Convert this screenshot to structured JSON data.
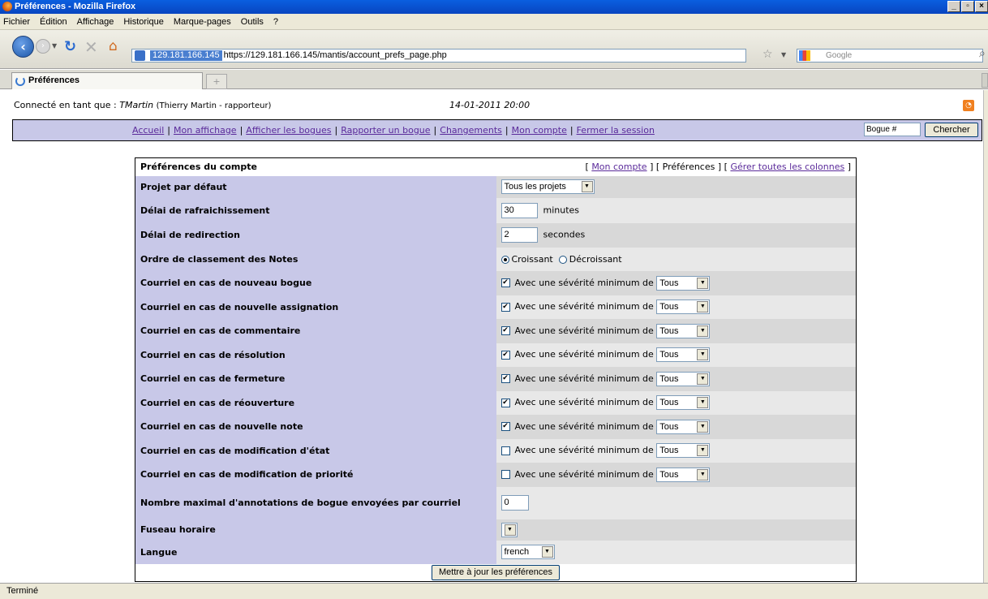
{
  "window": {
    "title": "Préférences - Mozilla Firefox"
  },
  "menubar": [
    "Fichier",
    "Édition",
    "Affichage",
    "Historique",
    "Marque-pages",
    "Outils",
    "?"
  ],
  "urlbar": {
    "site": "129.181.166.145",
    "url": "https://129.181.166.145/mantis/account_prefs_page.php"
  },
  "searchbar": {
    "placeholder": "Google"
  },
  "tab": {
    "title": "Préférences",
    "new_tab": "+"
  },
  "header": {
    "login_prefix": "Connecté en tant que :",
    "username": "TMartin",
    "user_detail": "(Thierry Martin - rapporteur)",
    "datetime": "14-01-2011 20:00"
  },
  "mainmenu": {
    "links": [
      "Accueil",
      "Mon affichage",
      "Afficher les bogues",
      "Rapporter un bogue",
      "Changements",
      "Mon compte",
      "Fermer la session"
    ],
    "separator": "|",
    "bug_input": "Bogue #",
    "search_button": "Chercher"
  },
  "form": {
    "title": "Préférences du compte",
    "nav": {
      "open": "[",
      "close": "]",
      "my_account": "Mon compte",
      "preferences": "Préférences",
      "manage_columns": "Gérer toutes les colonnes"
    },
    "default_project": {
      "label": "Projet par défaut",
      "value": "Tous les projets"
    },
    "refresh_delay": {
      "label": "Délai de rafraichissement",
      "value": "30",
      "unit": "minutes"
    },
    "redirect_delay": {
      "label": "Délai de redirection",
      "value": "2",
      "unit": "secondes"
    },
    "notes_order": {
      "label": "Ordre de classement des Notes",
      "opt1": "Croissant",
      "opt2": "Décroissant",
      "selected": "Croissant"
    },
    "severity_text": "Avec une sévérité minimum de",
    "severity_value": "Tous",
    "emails": [
      {
        "label": "Courriel en cas de nouveau bogue",
        "checked": true
      },
      {
        "label": "Courriel en cas de nouvelle assignation",
        "checked": true
      },
      {
        "label": "Courriel en cas de commentaire",
        "checked": true
      },
      {
        "label": "Courriel en cas de résolution",
        "checked": true
      },
      {
        "label": "Courriel en cas de fermeture",
        "checked": true
      },
      {
        "label": "Courriel en cas de réouverture",
        "checked": true
      },
      {
        "label": "Courriel en cas de nouvelle note",
        "checked": true
      },
      {
        "label": "Courriel en cas de modification d'état",
        "checked": false
      },
      {
        "label": "Courriel en cas de modification de priorité",
        "checked": false
      }
    ],
    "max_notes": {
      "label": "Nombre maximal d'annotations de bogue envoyées par courriel",
      "value": "0"
    },
    "timezone": {
      "label": "Fuseau horaire",
      "value": ""
    },
    "language": {
      "label": "Langue",
      "value": "french"
    },
    "submit": "Mettre à jour les préférences"
  },
  "statusbar": {
    "text": "Terminé"
  }
}
